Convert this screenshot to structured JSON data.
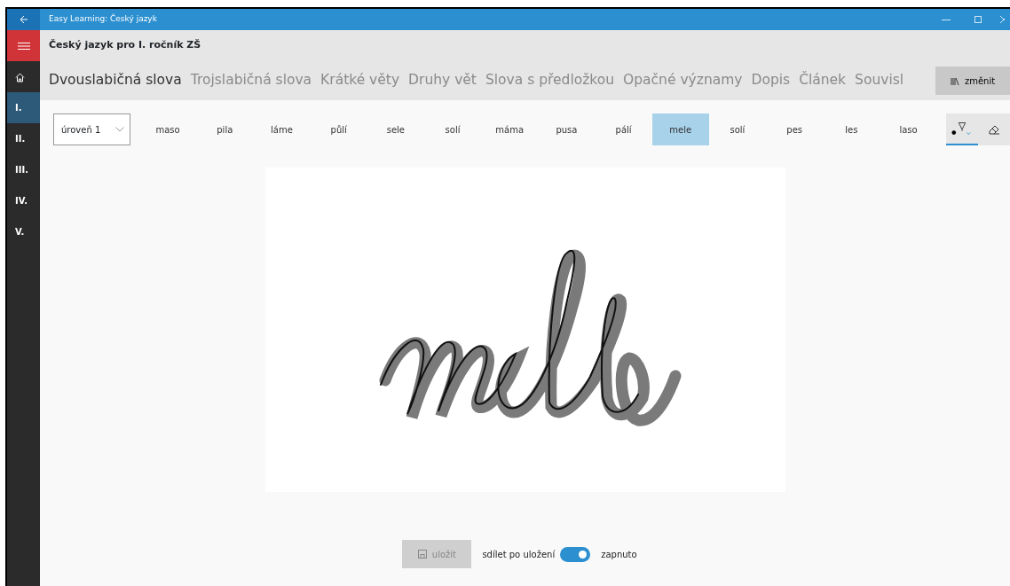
{
  "window": {
    "title": "Easy Learning: Český jazyk"
  },
  "sidebar": {
    "items": [
      {
        "kind": "home",
        "selected": false
      },
      {
        "kind": "text",
        "label": "I.",
        "selected": true
      },
      {
        "kind": "text",
        "label": "II.",
        "selected": false
      },
      {
        "kind": "text",
        "label": "III.",
        "selected": false
      },
      {
        "kind": "text",
        "label": "IV.",
        "selected": false
      },
      {
        "kind": "text",
        "label": "V.",
        "selected": false
      }
    ]
  },
  "header": {
    "title": "Český jazyk pro I. ročník ZŠ"
  },
  "tabs": [
    {
      "label": "Dvouslabičná slova",
      "selected": true
    },
    {
      "label": "Trojslabičná slova",
      "selected": false
    },
    {
      "label": "Krátké věty",
      "selected": false
    },
    {
      "label": "Druhy vět",
      "selected": false
    },
    {
      "label": "Slova s předložkou",
      "selected": false
    },
    {
      "label": "Opačné významy",
      "selected": false
    },
    {
      "label": "Dopis",
      "selected": false
    },
    {
      "label": "Článek",
      "selected": false
    },
    {
      "label": "Souvisl",
      "selected": false
    }
  ],
  "change_button": {
    "label": "změnit"
  },
  "level_dropdown": {
    "value": "úroveň 1"
  },
  "words": [
    {
      "label": "maso",
      "selected": false
    },
    {
      "label": "pila",
      "selected": false
    },
    {
      "label": "láme",
      "selected": false
    },
    {
      "label": "půlí",
      "selected": false
    },
    {
      "label": "sele",
      "selected": false
    },
    {
      "label": "solí",
      "selected": false
    },
    {
      "label": "máma",
      "selected": false
    },
    {
      "label": "pusa",
      "selected": false
    },
    {
      "label": "pálí",
      "selected": false
    },
    {
      "label": "mele",
      "selected": true
    },
    {
      "label": "solí",
      "selected": false
    },
    {
      "label": "pes",
      "selected": false
    },
    {
      "label": "les",
      "selected": false
    },
    {
      "label": "laso",
      "selected": false
    }
  ],
  "tools": [
    {
      "kind": "pen",
      "selected": true
    },
    {
      "kind": "eraser",
      "selected": false
    }
  ],
  "save_button": {
    "label": "uložit",
    "disabled": true
  },
  "share": {
    "label": "sdílet po uložení",
    "on": true,
    "state_text": "zapnuto"
  }
}
